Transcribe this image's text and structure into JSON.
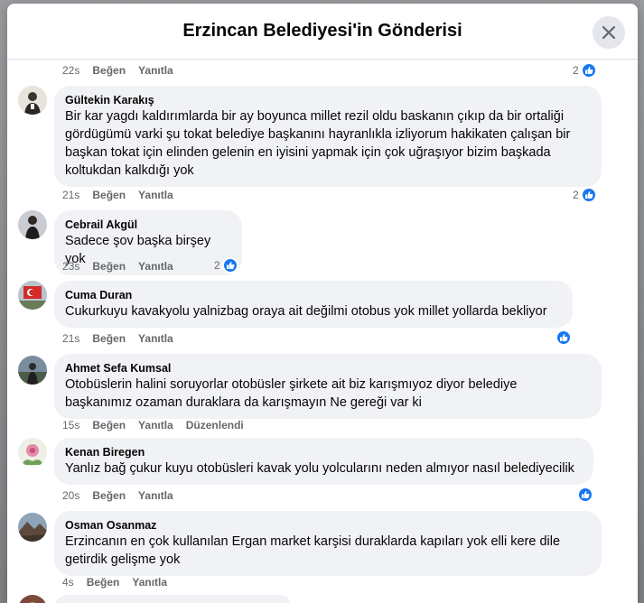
{
  "modal": {
    "title": "Erzincan Belediyesi'in Gönderisi"
  },
  "labels": {
    "like": "Beğen",
    "reply": "Yanıtla",
    "edited": "Düzenlendi"
  },
  "top_row": {
    "time": "22s",
    "reaction_count": "2"
  },
  "comments": [
    {
      "author": "Gültekin Karakış",
      "text_lines": [
        "Bir kar yagdı kaldırımlarda bir ay boyunca millet rezil oldu baskanın çıkıp da bir ortaliği",
        "gördügümü varki şu tokat belediye başkanını hayranlıkla izliyorum hakikaten çalışan bir",
        "başkan tokat için elinden gelenin en iyisini yapmak için çok uğraşıyor bizim başkada",
        "koltukdan kalkdığı yok"
      ],
      "time": "21s",
      "reaction_count": "2"
    },
    {
      "author": "Cebrail Akgül",
      "text_lines": [
        "Sadece şov başka birşey yok"
      ],
      "time": "23s",
      "reaction_count": "2"
    },
    {
      "author": "Cuma Duran",
      "text_lines": [
        "Cukurkuyu kavakyolu yalnizbag oraya ait değilmi otobus yok millet yollarda bekliyor"
      ],
      "time": "21s",
      "reaction_count": ""
    },
    {
      "author": "Ahmet Sefa Kumsal",
      "text_lines": [
        "Otobüslerin halini soruyorlar otobüsler şirkete ait biz karışmıyoz diyor belediye",
        "başkanımız ozaman duraklara da karışmayın Ne gereği var ki"
      ],
      "time": "15s",
      "reaction_count": "",
      "edited": true
    },
    {
      "author": "Kenan Biregen",
      "text_lines": [
        "Yanlız bağ çukur kuyu otobüsleri kavak yolu yolcularını neden almıyor nasıl belediyecilik"
      ],
      "time": "20s",
      "reaction_count": ""
    },
    {
      "author": "Osman Osanmaz",
      "text_lines": [
        "Erzincanın en çok kullanılan Ergan market karşisi duraklarda kapıları yok elli kere dile",
        "getirdik gelişme yok"
      ],
      "time": "4s",
      "reaction_count": ""
    }
  ],
  "colors": {
    "like_blue": "#1877f2",
    "bubble_bg": "#f0f2f5",
    "meta_gray": "#65676b"
  }
}
